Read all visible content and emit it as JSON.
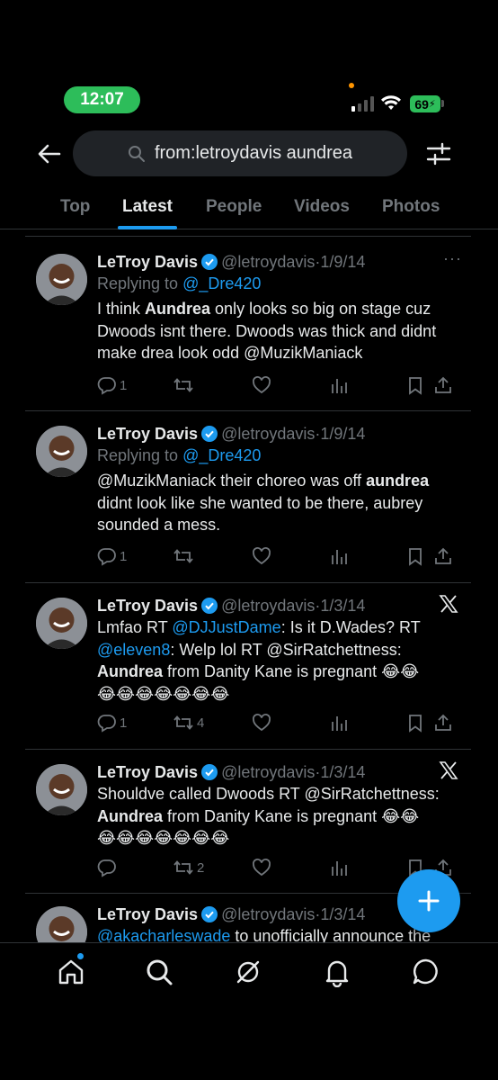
{
  "status_bar": {
    "time": "12:07",
    "battery": "69"
  },
  "search": {
    "query": "from:letroydavis aundrea"
  },
  "tabs": [
    {
      "label": "Top",
      "active": false
    },
    {
      "label": "Latest",
      "active": true
    },
    {
      "label": "People",
      "active": false
    },
    {
      "label": "Videos",
      "active": false
    },
    {
      "label": "Photos",
      "active": false
    }
  ],
  "colors": {
    "accent": "#1d9bf0",
    "background": "#000000",
    "muted": "#71767b",
    "status_green": "#2dbd5a"
  },
  "tweets": [
    {
      "name": "LeTroy Davis",
      "handle": "@letroydavis",
      "sep": "·",
      "date": "1/9/14",
      "reply_prefix": "Replying to ",
      "reply_to": "@_Dre420",
      "text_parts": [
        "I think ",
        "Aundrea",
        " only looks so big on stage cuz Dwoods isnt there. Dwoods was thick and didnt make drea look odd @MuzikManiack"
      ],
      "replies": "1",
      "retweets": "",
      "likes": ""
    },
    {
      "name": "LeTroy Davis",
      "handle": "@letroydavis",
      "sep": "·",
      "date": "1/9/14",
      "reply_prefix": "Replying to ",
      "reply_to": "@_Dre420",
      "text_parts": [
        "@MuzikManiack their choreo was off ",
        "aundrea",
        " didnt look like she wanted to be there, aubrey sounded a mess."
      ],
      "replies": "1",
      "retweets": "",
      "likes": ""
    },
    {
      "name": "LeTroy Davis",
      "handle": "@letroydavis",
      "sep": "·",
      "date": "1/3/14",
      "text_parts": [
        "Lmfao RT ",
        "@DJJustDame",
        ": Is it D.Wades? RT ",
        "@eleven8",
        ": Welp lol RT @SirRatchettness: ",
        "Aundrea",
        " from Danity Kane is pregnant ",
        "😂😂",
        "😂😂😂😂😂😂😂"
      ],
      "replies": "1",
      "retweets": "4",
      "likes": ""
    },
    {
      "name": "LeTroy Davis",
      "handle": "@letroydavis",
      "sep": "·",
      "date": "1/3/14",
      "text_parts": [
        "Shouldve called Dwoods RT @SirRatchettness: ",
        "Aundrea",
        " from Danity Kane is pregnant ",
        "😂😂",
        "😂😂😂😂😂😂😂"
      ],
      "replies": "",
      "retweets": "2",
      "likes": ""
    },
    {
      "name": "LeTroy Davis",
      "handle": "@letroydavis",
      "sep": "·",
      "date": "1/3/14",
      "text_parts": [
        "@akacharleswade",
        " to unofficially announce the"
      ]
    }
  ],
  "icons": {
    "back": "arrow-left-icon",
    "search": "search-icon",
    "filter": "filter-sliders-icon",
    "verified": "verified-badge-icon",
    "more": "more-dots-icon",
    "x": "x-logo-icon",
    "reply": "reply-icon",
    "retweet": "retweet-icon",
    "like": "heart-icon",
    "views": "views-icon",
    "bookmark": "bookmark-icon",
    "share": "share-icon",
    "compose": "plus-icon",
    "nav": [
      "home-icon",
      "search-icon",
      "grok-icon",
      "notifications-icon",
      "messages-icon"
    ]
  }
}
